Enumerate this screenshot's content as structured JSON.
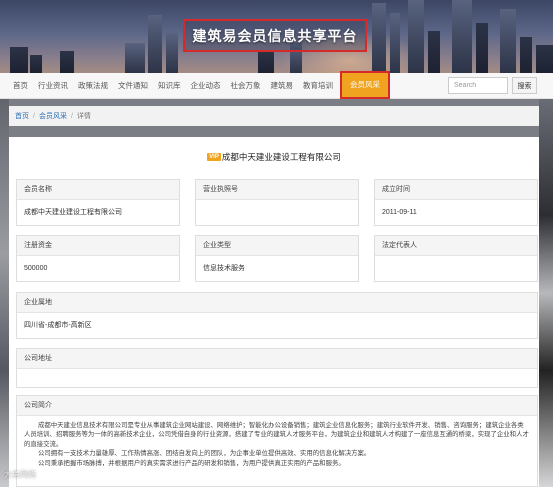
{
  "banner": {
    "title": "建筑易会员信息共享平台"
  },
  "nav": {
    "items": [
      "首页",
      "行业资讯",
      "政策法规",
      "文件通知",
      "知识库",
      "企业动态",
      "社会万象",
      "建筑易",
      "教育培训"
    ],
    "active": "会员风采",
    "search_placeholder": "Search",
    "search_button": "搜索"
  },
  "breadcrumb": {
    "home": "首页",
    "section": "会员风采",
    "current": "详情"
  },
  "company": {
    "badge": "VIP",
    "name": "成都中天建业建设工程有限公司"
  },
  "fields": {
    "member_name": {
      "label": "会员名称",
      "value": "成都中天建业建设工程有限公司"
    },
    "business_license": {
      "label": "营业执照号",
      "value": ""
    },
    "established": {
      "label": "成立时间",
      "value": "2011-09-11"
    },
    "registered_capital": {
      "label": "注册资金",
      "value": "500000"
    },
    "company_type": {
      "label": "企业类型",
      "value": "信息技术服务"
    },
    "legal_rep": {
      "label": "法定代表人",
      "value": ""
    },
    "location": {
      "label": "企业属地",
      "value": "四川省-成都市-高新区"
    },
    "address": {
      "label": "公司地址",
      "value": ""
    },
    "intro": {
      "label": "公司简介",
      "p1": "成都中天建业信息技术有限公司是专业从事建筑企业网站建设、网络维护；智能化办公设备销售；建筑企业信息化服务；建筑行业软件开发、销售、咨询服务；建筑企业各类人员培训、招聘服务等为一体的高新技术企业，公司凭借自身的行业资源，搭建了专业的建筑人才服务平台，为建筑企业和建筑人才构建了一座信息互通的桥梁，实现了企业和人才的直接交流。",
      "p2": "公司拥有一支技术力量雄厚、工作热情高涨、团结自发向上的团队，为企事业单位提供高效、实用的信息化解决方案。",
      "p3": "公司秉承把握市场脉搏，并根据用户的真实需求进行产品的研发和销售，为用户提供真正实用的产品和服务。"
    }
  },
  "watermark": "大鱼网络"
}
